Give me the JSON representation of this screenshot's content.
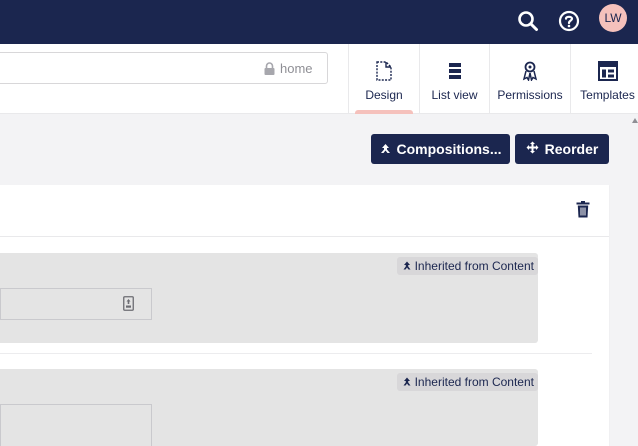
{
  "topbar": {
    "icons": [
      "search-icon",
      "help-icon"
    ],
    "avatar_initials": "LW",
    "background": "#1b264f",
    "avatar_color": "#f5c1bc"
  },
  "header": {
    "alias": "home",
    "tabs": [
      {
        "label": "Design",
        "icon": "document-icon",
        "active": true
      },
      {
        "label": "List view",
        "icon": "list-icon",
        "active": false
      },
      {
        "label": "Permissions",
        "icon": "permissions-icon",
        "active": false
      },
      {
        "label": "Templates",
        "icon": "templates-icon",
        "active": false
      }
    ]
  },
  "toolbar": {
    "compositions_label": "Compositions...",
    "reorder_label": "Reorder"
  },
  "group": {
    "properties": [
      {
        "inherited_label": "Inherited from Content"
      },
      {
        "inherited_label": "Inherited from Content"
      }
    ]
  },
  "colors": {
    "accent": "#1b264f",
    "indicator": "#f5c1bc",
    "property_bg": "#e4e4e4"
  }
}
